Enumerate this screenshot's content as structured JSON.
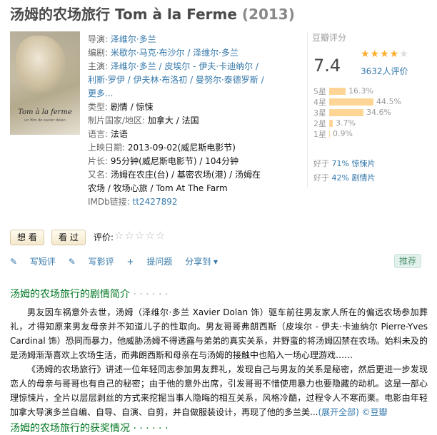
{
  "page_title": {
    "main": "汤姆的农场旅行 Tom à la Ferme",
    "year": "(2013)"
  },
  "poster": {
    "title": "Tom à la ferme",
    "subtitle": "un film de xavier dolan"
  },
  "info": {
    "director_label": "导演:",
    "director": "泽维尔·多兰",
    "writer_label": "编剧:",
    "writers": "米歇尔·马克·布沙尔 / 泽维尔·多兰",
    "cast_label": "主演:",
    "cast": "泽维尔·多兰 / 皮埃尔 - 伊夫·卡迪纳尔 / 利斯·罗伊 / 伊夫林·布洛初 / 曼努尔·泰德罗斯 / 更多...",
    "genre_label": "类型:",
    "genre": "剧情 / 惊悚",
    "country_label": "制片国家/地区:",
    "country": "加拿大 / 法国",
    "language_label": "语言:",
    "language": "法语",
    "release_label": "上映日期:",
    "release": "2013-09-02(威尼斯电影节)",
    "runtime_label": "片长:",
    "runtime": "95分钟(威尼斯电影节) / 104分钟",
    "aka_label": "又名:",
    "aka": "汤姆在农庄(台) / 基密农场(港) / 汤姆在农场 / 牧场心旅 / Tom At The Farm",
    "imdb_label": "IMDb链接:",
    "imdb": "tt2427892"
  },
  "rating": {
    "header": "豆瓣评分",
    "score": "7.4",
    "stars_filled": 4,
    "votes": "3632人评价",
    "distribution": [
      {
        "label": "5星",
        "percent": "16.3%",
        "value": 16.3
      },
      {
        "label": "4星",
        "percent": "44.5%",
        "value": 44.5
      },
      {
        "label": "3星",
        "percent": "34.6%",
        "value": 34.6
      },
      {
        "label": "2星",
        "percent": "3.7%",
        "value": 3.7
      },
      {
        "label": "1星",
        "percent": "0.9%",
        "value": 0.9
      }
    ],
    "better1_prefix": "好于 ",
    "better1_link": "71% 惊悚片",
    "better2_prefix": "好于 ",
    "better2_link": "42% 剧情片"
  },
  "actions": {
    "want": "想 看",
    "watched": "看 过",
    "rate_label": "评价:",
    "short_review": "写短评",
    "review": "写影评",
    "question": "提问题",
    "share": "分享到",
    "recommend": "推荐"
  },
  "summary": {
    "heading": "汤姆的农场旅行的剧情简介",
    "dots": "· · · · · ·",
    "p1": "男友因车祸意外去世，汤姆（泽维尔·多兰 Xavier Dolan 饰）驱车前往男友家人所在的偏远农场参加葬礼，才得知原来男友母亲并不知道儿子的性取向。男友哥哥弗朗西斯（皮埃尔 - 伊夫·卡迪纳尔 Pierre-Yves Cardinal 饰）恐同而暴力，他威胁汤姆不得透露与弟弟的真实关系，并野蛮的将汤姆囚禁在农场。始料未及的是汤姆渐渐喜欢上农场生活，而弗朗西斯和母亲在与汤姆的接触中也陷入一场心理游戏……",
    "p2": "《汤姆的农场旅行》讲述一位年轻同志参加男友葬礼，发现自己与男友的关系是秘密，然后更进一步发现恋人的母亲与哥哥也有自己的秘密；由于他的意外出席，引发哥哥不惜使用暴力也要隐藏的动机。这是一部心理惊悚片，全片以层层剥丝的方式来挖掘当事人隐晦的相互关系，风格冷酷，过程令人不寒而栗。电影由年轻加拿大导演多兰自编、自导、自演、自剪，并自做服装设计，再现了他的多兰美...",
    "expand": "(展开全部)",
    "source": "©豆瓣"
  }
}
